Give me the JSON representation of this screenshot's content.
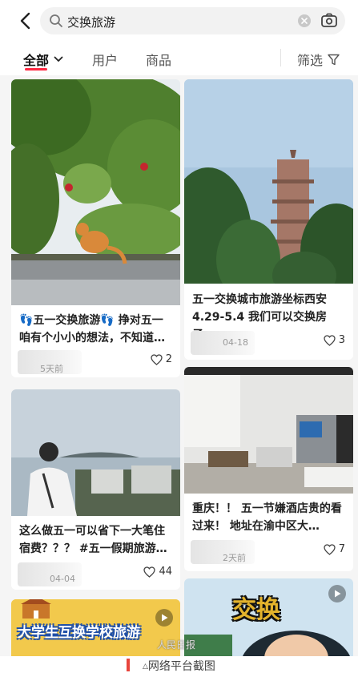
{
  "search": {
    "query": "交换旅游"
  },
  "tabs": {
    "all": "全部",
    "users": "用户",
    "products": "商品",
    "filter": "筛选"
  },
  "cards": [
    {
      "title": "👣五一交换旅游👣 挣对五一咱有个小小的想法，不知道…",
      "date": "5天前",
      "likes": "2"
    },
    {
      "title": "五一交换城市旅游坐标西安4.29-5.4 我们可以交换房子…",
      "date": "04-18",
      "likes": "3"
    },
    {
      "title": "这么做五一可以省下一大笔住宿费？？？ #五一假期旅游…",
      "date": "04-04",
      "likes": "44"
    },
    {
      "title": "重庆！！ 五一节嫌酒店贵的看过来！ 地址在渝中区大…",
      "date": "2天前",
      "likes": "7"
    },
    {
      "cover_text": "大学生互换学校旅游"
    },
    {
      "cover_text": "交换"
    }
  ],
  "watermark": "人民日报",
  "caption": "网络平台截图",
  "colors": {
    "accent": "#ff2741",
    "caption_bar": "#e8453c"
  }
}
